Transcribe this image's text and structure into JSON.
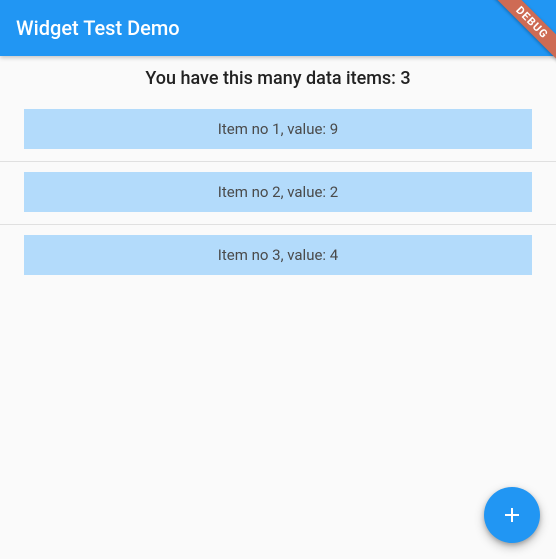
{
  "appbar": {
    "title": "Widget Test Demo"
  },
  "debug_banner": "DEBUG",
  "counter": {
    "prefix": "You have this many data items: ",
    "count": "3"
  },
  "items": [
    {
      "label": "Item no 1, value: 9"
    },
    {
      "label": "Item no 2, value: 2"
    },
    {
      "label": "Item no 3, value: 4"
    }
  ],
  "fab": {
    "icon": "plus-icon"
  }
}
